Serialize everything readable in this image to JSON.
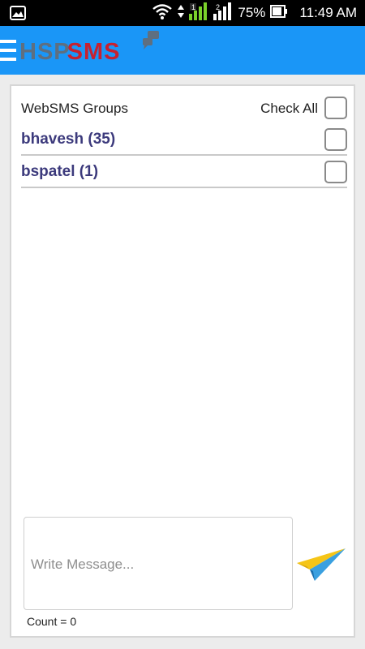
{
  "status_bar": {
    "battery": "75%",
    "time": "11:49 AM",
    "sim1": "1",
    "sim2": "2"
  },
  "app_bar": {
    "logo_left": "HSP",
    "logo_right": "SMS",
    "accent_color": "#1a96f7"
  },
  "groups_panel": {
    "title": "WebSMS Groups",
    "check_all_label": "Check All",
    "items": [
      {
        "label": "bhavesh (35)"
      },
      {
        "label": "bspatel (1)"
      }
    ]
  },
  "composer": {
    "placeholder": "Write Message...",
    "value": "",
    "count_label": "Count = 0"
  },
  "icons": {
    "menu": "menu-icon",
    "send": "send-paper-plane-icon",
    "gallery": "image-icon",
    "wifi": "wifi-icon",
    "signal": "signal-icon",
    "battery": "battery-icon"
  }
}
